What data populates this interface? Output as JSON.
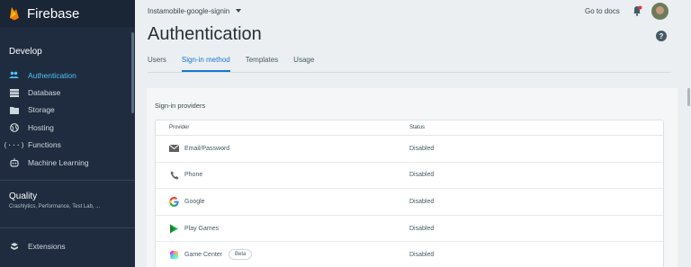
{
  "brand": {
    "name": "Firebase"
  },
  "sidebar": {
    "develop_title": "Develop",
    "items": [
      {
        "label": "Authentication",
        "icon": "people-icon",
        "active": true
      },
      {
        "label": "Database",
        "icon": "database-icon",
        "active": false
      },
      {
        "label": "Storage",
        "icon": "folder-icon",
        "active": false
      },
      {
        "label": "Hosting",
        "icon": "globe-icon",
        "active": false
      },
      {
        "label": "Functions",
        "icon": "functions-icon",
        "active": false
      },
      {
        "label": "Machine Learning",
        "icon": "robot-icon",
        "active": false
      }
    ],
    "quality_title": "Quality",
    "quality_sub": "Crashlytics, Performance, Test Lab, ...",
    "extensions_label": "Extensions"
  },
  "topbar": {
    "project": "Instamobile-google-signin",
    "goto_docs": "Go to docs"
  },
  "page": {
    "title": "Authentication",
    "help": "?",
    "tabs": [
      {
        "label": "Users",
        "active": false
      },
      {
        "label": "Sign-in method",
        "active": true
      },
      {
        "label": "Templates",
        "active": false
      },
      {
        "label": "Usage",
        "active": false
      }
    ]
  },
  "providers": {
    "title": "Sign-in providers",
    "col_provider": "Provider",
    "col_status": "Status",
    "rows": [
      {
        "name": "Email/Password",
        "status": "Disabled",
        "icon": "mail-icon"
      },
      {
        "name": "Phone",
        "status": "Disabled",
        "icon": "phone-icon"
      },
      {
        "name": "Google",
        "status": "Disabled",
        "icon": "google-icon"
      },
      {
        "name": "Play Games",
        "status": "Disabled",
        "icon": "play-games-icon"
      },
      {
        "name": "Game Center",
        "status": "Disabled",
        "icon": "game-center-icon",
        "badge": "Beta"
      }
    ]
  },
  "colors": {
    "sidebar_bg": "#1f2c3f",
    "accent": "#1976d2",
    "active_nav": "#4fc3f7"
  }
}
